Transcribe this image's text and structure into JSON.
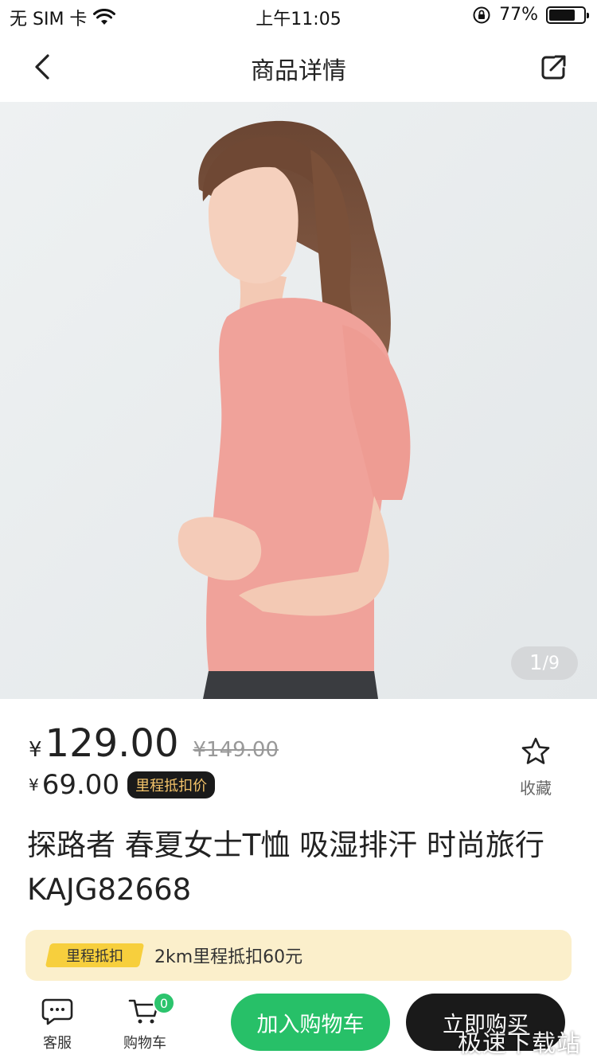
{
  "status_bar": {
    "carrier": "无 SIM 卡",
    "time": "上午11:05",
    "battery_text": "77%",
    "battery_level": 0.77
  },
  "nav": {
    "title": "商品详情",
    "back_icon": "chevron-left-icon",
    "share_icon": "share-icon"
  },
  "gallery": {
    "current": "1",
    "separator": "/",
    "total": "9"
  },
  "price": {
    "currency": "¥",
    "current": "129.00",
    "original": "¥149.00",
    "mileage_currency": "¥",
    "mileage_price": "69.00",
    "mileage_tag": "里程抵扣价"
  },
  "favorite": {
    "label": "收藏",
    "icon": "star-icon"
  },
  "product": {
    "title": "探路者 春夏女士T恤 吸湿排汗 时尚旅行 KAJG82668"
  },
  "promo": {
    "tag": "里程抵扣",
    "text": "2km里程抵扣60元"
  },
  "bottom_bar": {
    "service_label": "客服",
    "cart_label": "购物车",
    "cart_count": "0",
    "add_to_cart": "加入购物车",
    "buy_now": "立即购买"
  },
  "watermark": "极速下载站",
  "colors": {
    "accent_green": "#27c068",
    "dark": "#1a1a1a",
    "promo_bg": "#fbefcb",
    "promo_tag": "#f7cf3d",
    "mileage_tag_text": "#f4c46a",
    "shirt_pink": "#f0a29a"
  }
}
